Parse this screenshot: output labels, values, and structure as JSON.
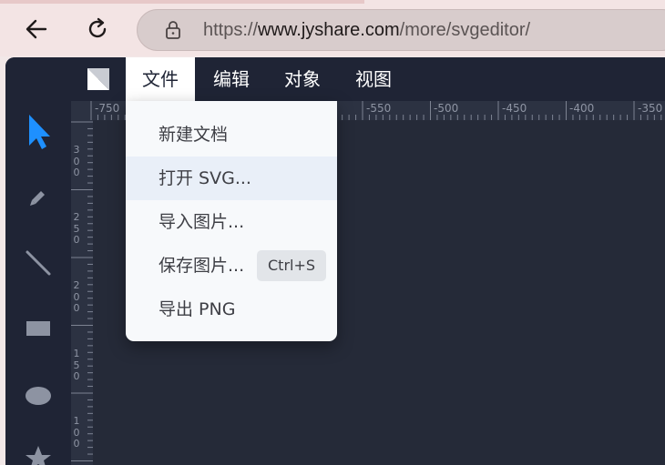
{
  "browser": {
    "url_prefix": "https://",
    "url_host": "www.jyshare.com",
    "url_path": "/more/svgeditor/",
    "back_icon": "arrow-left-icon",
    "reload_icon": "reload-icon",
    "lock_icon": "lock-icon"
  },
  "menubar": {
    "items": [
      {
        "label": "文件",
        "active": true
      },
      {
        "label": "编辑",
        "active": false
      },
      {
        "label": "对象",
        "active": false
      },
      {
        "label": "视图",
        "active": false
      }
    ]
  },
  "file_menu": {
    "items": [
      {
        "label": "新建文档"
      },
      {
        "label": "打开 SVG...",
        "hover": true
      },
      {
        "label": "导入图片..."
      },
      {
        "label": "保存图片...",
        "shortcut": "Ctrl+S"
      },
      {
        "label": "导出 PNG"
      }
    ]
  },
  "ruler": {
    "top_labels": [
      "-750",
      "-550",
      "-500",
      "-450",
      "-400",
      "-350"
    ],
    "left_labels": [
      "300",
      "250",
      "200",
      "150",
      "100"
    ]
  },
  "tools": [
    "select-arrow-icon",
    "pencil-icon",
    "line-icon",
    "rectangle-icon",
    "ellipse-icon",
    "star-icon"
  ],
  "colors": {
    "app_bg": "#212637",
    "canvas_bg": "#252a38",
    "select_tool": "#1e90ff",
    "menu_hover": "#e9eff8"
  }
}
